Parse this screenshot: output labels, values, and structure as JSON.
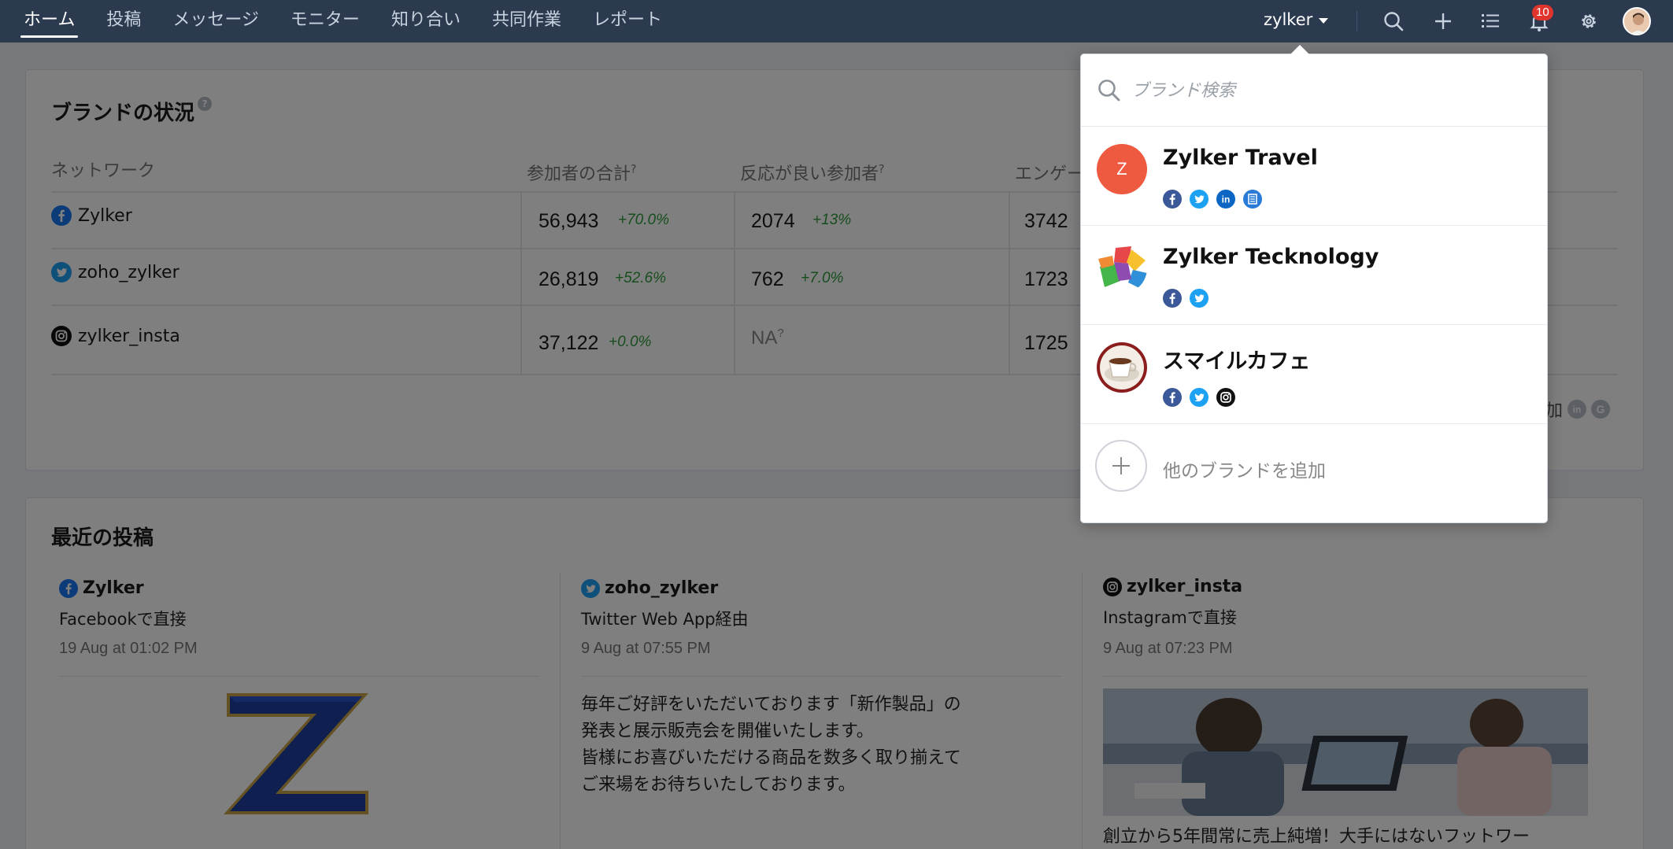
{
  "nav": {
    "items": [
      "ホーム",
      "投稿",
      "メッセージ",
      "モニター",
      "知り合い",
      "共同作業",
      "レポート"
    ],
    "active_index": 0,
    "brand_switch": "zylker",
    "notification_count": "10"
  },
  "brand_status": {
    "title": "ブランドの状況",
    "help": "?",
    "headers": {
      "network": "ネットワーク",
      "total": "参加者の合計",
      "engaged": "反応が良い参加者",
      "engagement": "エンゲー",
      "superscript": "?"
    },
    "rows": [
      {
        "network": "facebook",
        "name": "Zylker",
        "total": "56,943",
        "total_delta": "+70.0%",
        "engaged": "2074",
        "engaged_delta": "+13%",
        "engagement": "3742"
      },
      {
        "network": "twitter",
        "name": "zoho_zylker",
        "total": "26,819",
        "total_delta": "+52.6%",
        "engaged": "762",
        "engaged_delta": "+7.0%",
        "engagement": "1723"
      },
      {
        "network": "instagram",
        "name": "zylker_insta",
        "total": "37,122",
        "total_delta": "+0.0%",
        "engaged": "NA",
        "engaged_delta": "",
        "engagement": "1725"
      }
    ],
    "add_network_partial": "加"
  },
  "recent_posts": {
    "title": "最近の投稿",
    "posts": [
      {
        "network": "facebook",
        "account": "Zylker",
        "via": "Facebookで直接",
        "time": "19 Aug at 01:02 PM",
        "media": "zylker-logo-image"
      },
      {
        "network": "twitter",
        "account": "zoho_zylker",
        "via": "Twitter Web App経由",
        "time": "9 Aug at 07:55 PM",
        "text": [
          "毎年ご好評をいただいております「新作製品」の",
          "発表と展示販売会を開催いたします。",
          "皆様にお喜びいただける商品を数多く取り揃えて",
          "ご来場をお待ちいたしております。"
        ]
      },
      {
        "network": "instagram",
        "account": "zylker_insta",
        "via": "Instagramで直接",
        "time": "9 Aug at 07:23 PM",
        "media": "office-meeting-photo",
        "caption": "創立から5年間常に売上純増！大手にはないフットワー"
      }
    ]
  },
  "brand_dropdown": {
    "search_placeholder": "ブランド検索",
    "brands": [
      {
        "name": "Zylker Travel",
        "logo_letter": "Z",
        "logo_color": "#ee5a3f",
        "networks": [
          "facebook",
          "twitter",
          "linkedin",
          "google-business"
        ]
      },
      {
        "name": "Zylker Tecknology",
        "logo": "colorful-cubes-logo",
        "networks": [
          "facebook",
          "twitter"
        ]
      },
      {
        "name": "スマイルカフェ",
        "logo": "coffee-cup-logo",
        "networks": [
          "facebook",
          "twitter",
          "instagram"
        ]
      }
    ],
    "add_label": "他のブランドを追加"
  },
  "colors": {
    "topbar": "#2b3a4f",
    "positive_delta": "#2e9d3a",
    "facebook": "#1877f2",
    "twitter": "#1da1f2",
    "linkedin": "#0a66c2",
    "badge": "#e0342c"
  }
}
